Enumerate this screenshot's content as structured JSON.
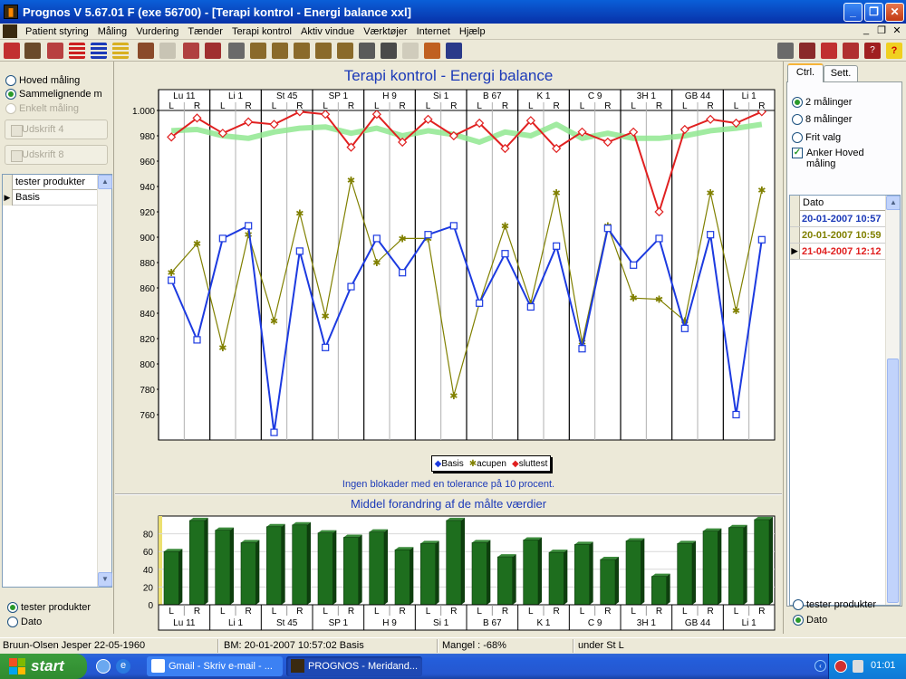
{
  "window": {
    "title": "Prognos V 5.67.01 F  (exe 56700) - [Terapi kontrol - Energi balance xxl]"
  },
  "menu": [
    "Patient styring",
    "Måling",
    "Vurdering",
    "Tænder",
    "Terapi kontrol",
    "Aktiv vindue",
    "Værktøjer",
    "Internet",
    "Hjælp"
  ],
  "left": {
    "radios": [
      {
        "label": "Hoved måling",
        "selected": false,
        "disabled": false
      },
      {
        "label": "Sammelignende m",
        "selected": true,
        "disabled": false
      },
      {
        "label": "Enkelt måling",
        "selected": false,
        "disabled": true
      }
    ],
    "print4": "Udskrift 4",
    "print8": "Udskrift 8",
    "list_header": "tester produkter",
    "list_items": [
      "Basis"
    ],
    "bottom_radios": [
      {
        "label": "tester produkter",
        "selected": true
      },
      {
        "label": "Dato",
        "selected": false
      }
    ]
  },
  "right": {
    "tabs": [
      "Ctrl.",
      "Sett."
    ],
    "radios": [
      {
        "label": "2 målinger",
        "selected": true
      },
      {
        "label": "8 målinger",
        "selected": false
      },
      {
        "label": "Frit valg",
        "selected": false
      }
    ],
    "checkbox": {
      "label": "Anker Hoved måling",
      "checked": true
    },
    "date_header": "Dato",
    "dates": [
      {
        "text": "20-01-2007 10:57",
        "color": "#1c3ab8"
      },
      {
        "text": "20-01-2007 10:59",
        "color": "#808000"
      },
      {
        "text": "21-04-2007 12:12",
        "color": "#e02020"
      }
    ],
    "bottom_radios": [
      {
        "label": "tester produkter",
        "selected": false
      },
      {
        "label": "Dato",
        "selected": true
      }
    ]
  },
  "chart_title": "Terapi kontrol - Energi balance",
  "lr": {
    "L": "L",
    "R": "R"
  },
  "groups": [
    "Lu 11",
    "Li 1",
    "St 45",
    "SP 1",
    "H 9",
    "Si 1",
    "B 67",
    "K 1",
    "C 9",
    "3H 1",
    "GB 44",
    "Li 1"
  ],
  "note": "Ingen blokader med en tolerance på 10 procent.",
  "bar_title": "Middel forandring af de målte værdier",
  "status": {
    "patient": "Bruun-Olsen Jesper 22-05-1960",
    "bm": "BM: 20-01-2007 10:57:02  Basis",
    "mangel": "Mangel : -68%",
    "under": "under St L"
  },
  "taskbar": {
    "start": "start",
    "tasks": [
      "Gmail - Skriv e-mail - ...",
      "PROGNOS - Meridand..."
    ],
    "clock": "01:01"
  },
  "colors": {
    "basis": "#1c3ae0",
    "acupen": "#808000",
    "sluttest": "#e02020",
    "green_band": "#90e890",
    "bars": "#1e6e1e"
  },
  "chart_data": [
    {
      "type": "line",
      "categories": [
        "Lu 11 L",
        "Lu 11 R",
        "Li 1 L",
        "Li 1 R",
        "St 45 L",
        "St 45 R",
        "SP 1 L",
        "SP 1 R",
        "H 9 L",
        "H 9 R",
        "Si 1 L",
        "Si 1 R",
        "B 67 L",
        "B 67 R",
        "K 1 L",
        "K 1 R",
        "C 9 L",
        "C 9 R",
        "3H 1 L",
        "3H 1 R",
        "GB 44 L",
        "GB 44 R",
        "Li 1 L",
        "Li 1 R"
      ],
      "ylim": [
        740,
        1000
      ],
      "yticks": [
        "1.000",
        "980",
        "960",
        "940",
        "920",
        "900",
        "880",
        "860",
        "840",
        "820",
        "800",
        "780",
        "760"
      ],
      "series": [
        {
          "name": "Basis",
          "color": "#1c3ae0",
          "values": [
            866,
            819,
            899,
            909,
            746,
            889,
            813,
            861,
            899,
            872,
            902,
            909,
            848,
            887,
            845,
            893,
            812,
            907,
            878,
            899,
            828,
            902,
            760,
            898
          ]
        },
        {
          "name": "acupen",
          "color": "#808000",
          "values": [
            872,
            895,
            813,
            902,
            834,
            919,
            838,
            945,
            880,
            899,
            899,
            775,
            848,
            909,
            848,
            935,
            817,
            909,
            852,
            851,
            834,
            935,
            842,
            937
          ]
        },
        {
          "name": "sluttest",
          "color": "#e02020",
          "values": [
            979,
            994,
            982,
            991,
            989,
            999,
            997,
            971,
            997,
            975,
            993,
            980,
            990,
            970,
            992,
            970,
            983,
            975,
            983,
            920,
            985,
            993,
            990,
            999
          ]
        },
        {
          "color": "#90e890",
          "values": [
            984,
            985,
            980,
            978,
            983,
            986,
            987,
            982,
            986,
            980,
            984,
            981,
            975,
            983,
            980,
            989,
            978,
            982,
            978,
            978,
            980,
            984,
            986,
            989
          ]
        }
      ]
    },
    {
      "type": "bar",
      "yticks": [
        "80",
        "60",
        "40",
        "20",
        "0"
      ],
      "ylim": [
        0,
        100
      ],
      "values": [
        60,
        95,
        84,
        70,
        88,
        90,
        81,
        76,
        82,
        62,
        69,
        95,
        70,
        54,
        73,
        59,
        68,
        51,
        72,
        32,
        69,
        83,
        87,
        96
      ]
    }
  ]
}
